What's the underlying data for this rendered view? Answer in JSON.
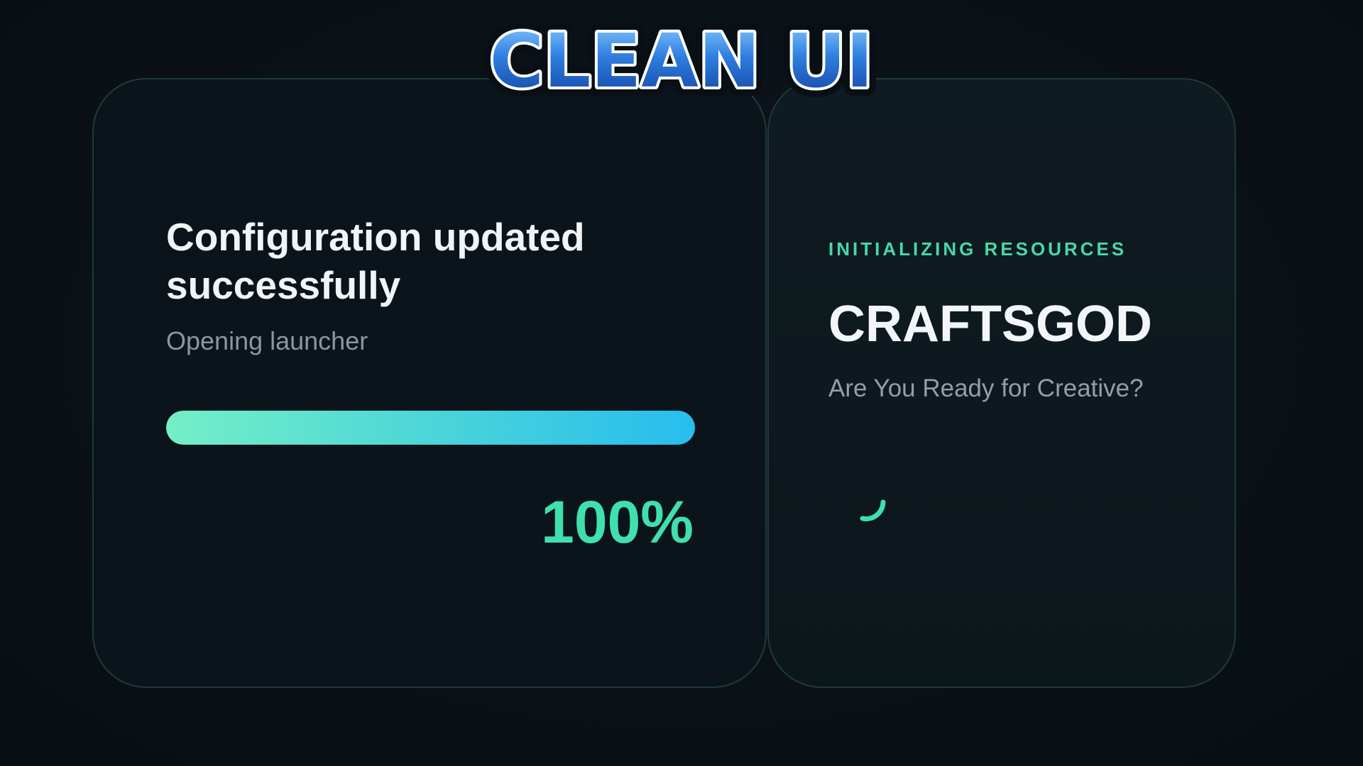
{
  "overlay": {
    "banner_text": "CLEAN UI"
  },
  "status_card": {
    "title": "Configuration updated successfully",
    "subtitle": "Opening launcher",
    "progress": {
      "fraction": 1.0,
      "label": "100%"
    }
  },
  "splash_card": {
    "eyebrow": "INITIALIZING RESOURCES",
    "brand": "CRAFTSGOD",
    "tagline": "Are You Ready for Creative?",
    "spinner_icon": "loading-spinner-icon"
  },
  "colors": {
    "accent_green": "#3fe0ac",
    "eyebrow_green": "#48d8a6",
    "progress_start": "#74efc6",
    "progress_end": "#27bdee",
    "banner_blue": "#2e7ee0",
    "background": "#0a1117"
  }
}
